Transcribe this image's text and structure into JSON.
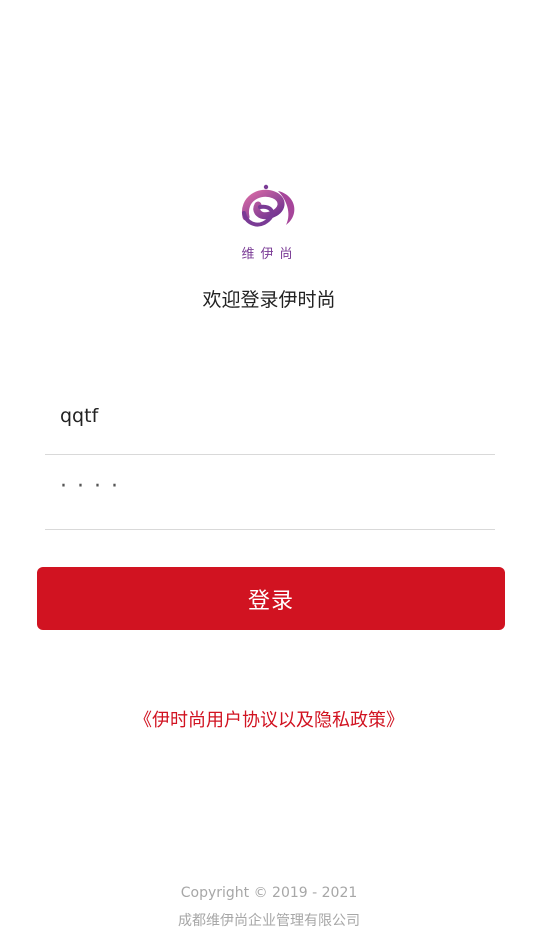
{
  "brand": {
    "logo_icon": "e-letter-logo-icon",
    "logo_text": "维伊尚",
    "colors": {
      "primary_red": "#d11321",
      "logo_purple": "#7a3b95",
      "logo_pink": "#d96ba6"
    }
  },
  "welcome": {
    "text": "欢迎登录伊时尚"
  },
  "login_form": {
    "username_value": "qqtf",
    "password_value": "····",
    "submit_label": "登录"
  },
  "agreement": {
    "text": "《伊时尚用户协议以及隐私政策》"
  },
  "footer": {
    "copyright": "Copyright © 2019 - 2021",
    "company": "成都维伊尚企业管理有限公司"
  }
}
